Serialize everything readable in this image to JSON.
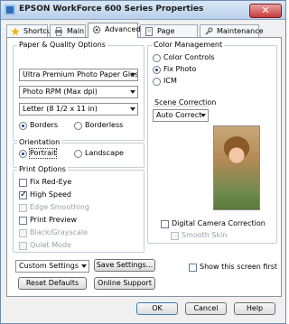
{
  "window": {
    "title": "EPSON WorkForce 600 Series Properties",
    "close_label": "✕"
  },
  "tabs": [
    {
      "label": "Shortcuts",
      "icon": "star-icon"
    },
    {
      "label": "Main",
      "icon": "printer-icon"
    },
    {
      "label": "Advanced",
      "icon": "gear-icon"
    },
    {
      "label": "Page Layout",
      "icon": "page-icon"
    },
    {
      "label": "Maintenance",
      "icon": "wrench-icon"
    }
  ],
  "paper_quality": {
    "title": "Paper & Quality Options",
    "paper_type": "Ultra Premium Photo Paper Glossy",
    "quality": "Photo RPM (Max dpi)",
    "size": "Letter (8 1/2 x 11 in)",
    "borders_label": "Borders",
    "borderless_label": "Borderless"
  },
  "orientation": {
    "title": "Orientation",
    "portrait": "Portrait",
    "landscape": "Landscape"
  },
  "print_options": {
    "title": "Print Options",
    "items": [
      "Fix Red-Eye",
      "High Speed",
      "Edge Smoothing",
      "Print Preview",
      "Black/Grayscale",
      "Quiet Mode"
    ]
  },
  "color_management": {
    "title": "Color Management",
    "options": [
      "Color Controls",
      "Fix Photo",
      "ICM"
    ],
    "scene_title": "Scene Correction",
    "scene_value": "Auto Correct",
    "digital_camera": "Digital Camera Correction",
    "smooth_skin": "Smooth Skin"
  },
  "bottom": {
    "custom_settings": "Custom Settings",
    "save_settings": "Save Settings...",
    "reset_defaults": "Reset Defaults",
    "online_support": "Online Support",
    "show_first": "Show this screen first",
    "ok": "OK",
    "cancel": "Cancel",
    "help": "Help"
  }
}
